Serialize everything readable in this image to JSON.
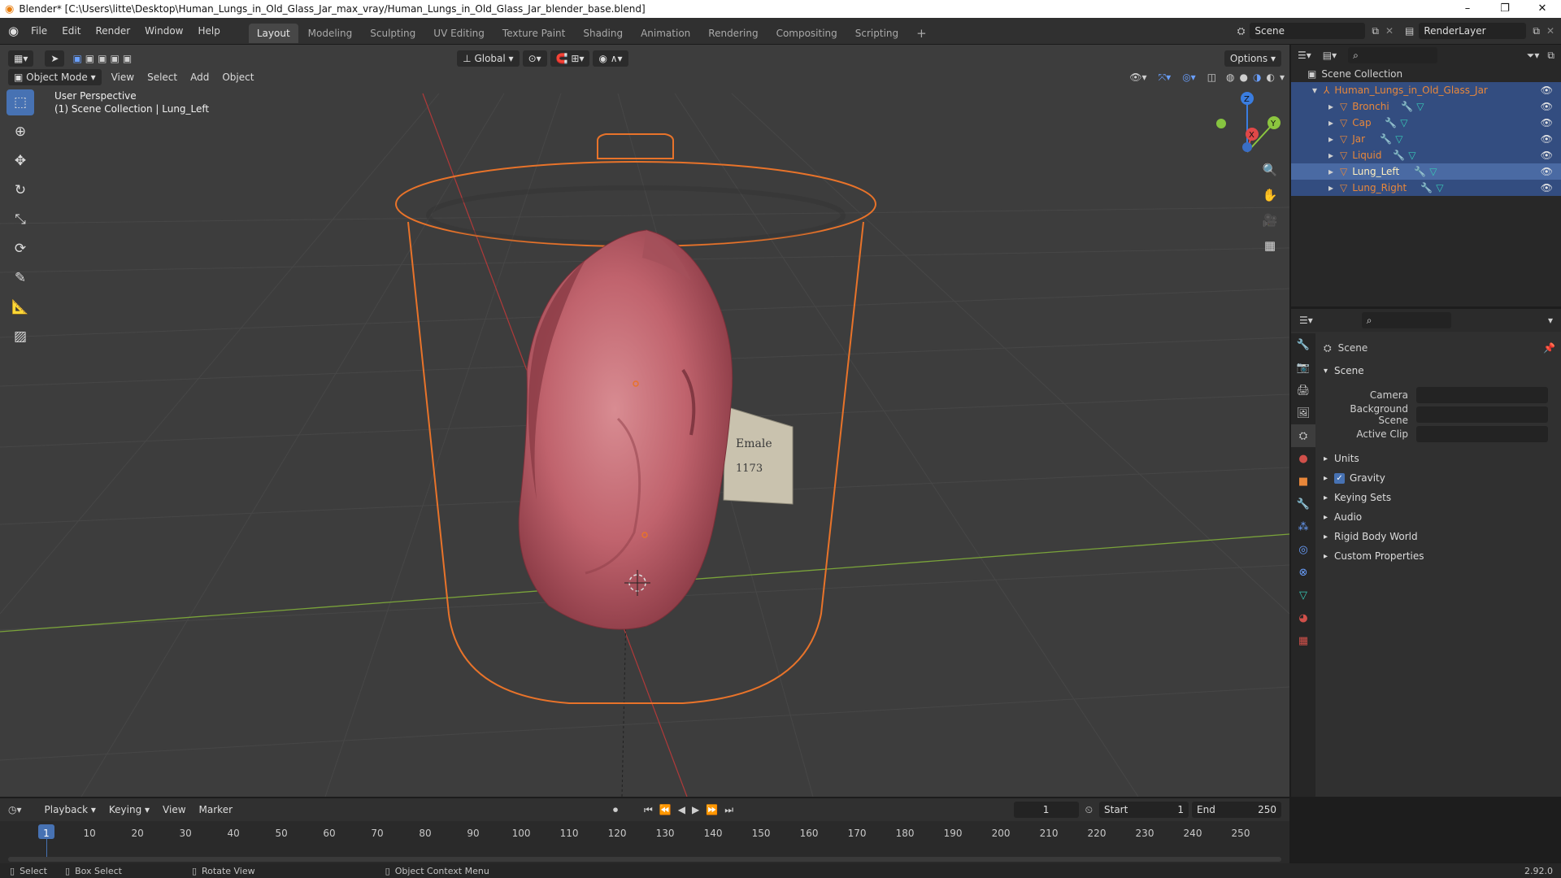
{
  "window": {
    "title": "Blender* [C:\\Users\\litte\\Desktop\\Human_Lungs_in_Old_Glass_Jar_max_vray/Human_Lungs_in_Old_Glass_Jar_blender_base.blend]",
    "controls": [
      "–",
      "❐",
      "✕"
    ]
  },
  "menu": [
    "File",
    "Edit",
    "Render",
    "Window",
    "Help"
  ],
  "workspaces": {
    "active": "Layout",
    "tabs": [
      "Layout",
      "Modeling",
      "Sculpting",
      "UV Editing",
      "Texture Paint",
      "Shading",
      "Animation",
      "Rendering",
      "Compositing",
      "Scripting"
    ],
    "add_label": "+"
  },
  "scene_selector": {
    "value": "Scene"
  },
  "viewlayer_selector": {
    "value": "RenderLayer"
  },
  "viewport": {
    "mode": "Object Mode",
    "menus": [
      "View",
      "Select",
      "Add",
      "Object"
    ],
    "transform_orientation": "Global",
    "options_label": "Options",
    "perspective": "User Perspective",
    "context": "(1) Scene Collection | Lung_Left",
    "gizmo": {
      "x": "X",
      "y": "Y",
      "z": "Z"
    },
    "label_text_1": "Emale",
    "label_text_2": "1173"
  },
  "outliner": {
    "root": "Scene Collection",
    "collection": "Human_Lungs_in_Old_Glass_Jar",
    "objects": [
      {
        "name": "Bronchi",
        "active": false
      },
      {
        "name": "Cap",
        "active": false
      },
      {
        "name": "Jar",
        "active": false
      },
      {
        "name": "Liquid",
        "active": false
      },
      {
        "name": "Lung_Left",
        "active": true
      },
      {
        "name": "Lung_Right",
        "active": false
      }
    ]
  },
  "properties": {
    "context": "Scene",
    "panel_title": "Scene",
    "fields": [
      {
        "label": "Camera",
        "value": ""
      },
      {
        "label": "Background Scene",
        "value": ""
      },
      {
        "label": "Active Clip",
        "value": ""
      }
    ],
    "sections": [
      {
        "label": "Units",
        "checkbox": false
      },
      {
        "label": "Gravity",
        "checkbox": true
      },
      {
        "label": "Keying Sets",
        "checkbox": false
      },
      {
        "label": "Audio",
        "checkbox": false
      },
      {
        "label": "Rigid Body World",
        "checkbox": false
      },
      {
        "label": "Custom Properties",
        "checkbox": false
      }
    ]
  },
  "timeline": {
    "menus": [
      "Playback",
      "Keying",
      "View",
      "Marker"
    ],
    "current_frame": "1",
    "start_label": "Start",
    "start": "1",
    "end_label": "End",
    "end": "250",
    "ticks": [
      "1",
      "10",
      "20",
      "30",
      "40",
      "50",
      "60",
      "70",
      "80",
      "90",
      "100",
      "110",
      "120",
      "130",
      "140",
      "150",
      "160",
      "170",
      "180",
      "190",
      "200",
      "210",
      "220",
      "230",
      "240",
      "250"
    ]
  },
  "statusbar": {
    "items": [
      "Select",
      "Box Select",
      "Rotate View",
      "Object Context Menu"
    ],
    "version": "2.92.0"
  },
  "colors": {
    "selection_orange": "#e8873a",
    "active_blue": "#4772b3",
    "axis_red": "#e04848",
    "axis_green": "#8cc63f",
    "axis_blue": "#3a7de0"
  }
}
